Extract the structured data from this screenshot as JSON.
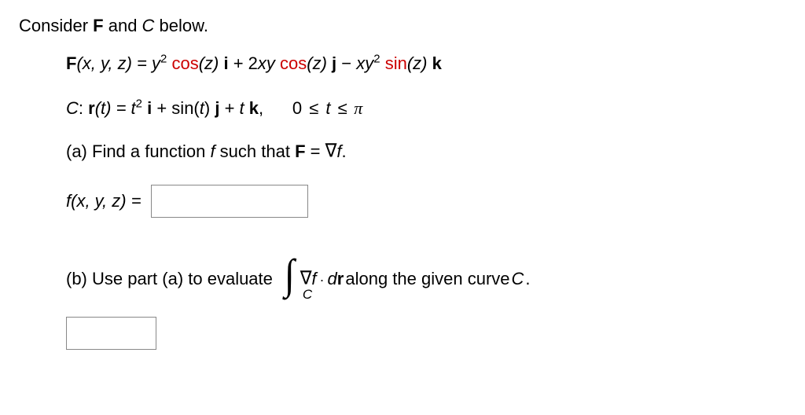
{
  "intro_prefix": "Consider ",
  "intro_F": "F",
  "intro_and": " and ",
  "intro_C": "C",
  "intro_suffix": " below.",
  "F_label": "F",
  "F_args": "(x, y, z) = ",
  "F_term1_y": "y",
  "F_term1_exp": "2",
  "F_term1_cos": "cos",
  "F_term1_paren": "(z) ",
  "F_term1_vec": "i",
  "F_plus1": " + 2",
  "F_term2_xy": "xy ",
  "F_term2_cos": "cos",
  "F_term2_paren": "(z) ",
  "F_term2_vec": "j",
  "F_minus": " − ",
  "F_term3_xy": "xy",
  "F_term3_exp": "2",
  "F_term3_sin": "sin",
  "F_term3_paren": "(z) ",
  "F_term3_vec": "k",
  "C_label": "C",
  "C_colon": ": ",
  "C_r": "r",
  "C_args": "(t) = ",
  "C_t": "t",
  "C_t_exp": "2",
  "C_i": "i",
  "C_plus1": " + sin(",
  "C_targ": "t",
  "C_close1": ") ",
  "C_j": "j",
  "C_plus2": " + ",
  "C_t2": "t ",
  "C_k": "k",
  "C_comma": ",",
  "C_range_0": "0 ",
  "C_le1": "≤",
  "C_tvar": " t ",
  "C_le2": "≤",
  "C_pi": " π",
  "part_a_prefix": "(a) Find a function ",
  "part_a_f": "f ",
  "part_a_mid": "such that ",
  "part_a_F": "F",
  "part_a_eq": " = ",
  "part_a_grad": "∇",
  "part_a_fend": "f",
  "part_a_period": ".",
  "fxyz_f": "f",
  "fxyz_args": "(x, y, z) = ",
  "part_b_prefix": "(b) Use part (a) to evaluate ",
  "int_sub": "C",
  "int_grad": "∇",
  "int_f": "f",
  "int_dot": "·",
  "int_d": "d",
  "int_r": "r",
  "part_b_suffix": "  along the given curve ",
  "part_b_C": "C",
  "part_b_period": "."
}
